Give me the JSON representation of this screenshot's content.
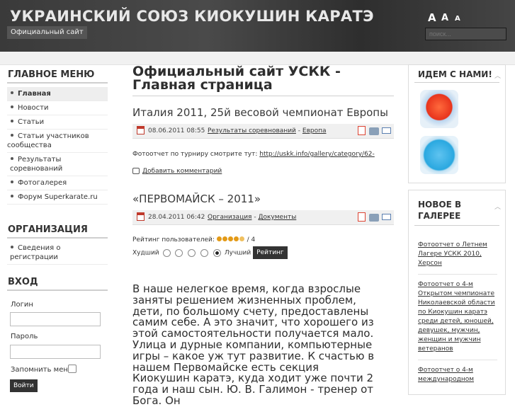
{
  "header": {
    "site_title": "УКРАИНСКИЙ СОЮЗ КИОКУШИН КАРАТЭ",
    "slogan": "Официальный сайт",
    "font_increase": "A",
    "font_reset": "A",
    "font_decrease": "A",
    "search_placeholder": "поиск..."
  },
  "main_menu": {
    "title": "ГЛАВНОЕ МЕНЮ",
    "items": [
      {
        "label": "Главная"
      },
      {
        "label": "Новости"
      },
      {
        "label": "Статьи"
      },
      {
        "label": "Статьи участников сообщества"
      },
      {
        "label": "Результаты соревнований"
      },
      {
        "label": "Фотогалерея"
      },
      {
        "label": "Форум Superkarate.ru"
      }
    ]
  },
  "org_menu": {
    "title": "ОРГАНИЗАЦИЯ",
    "items": [
      {
        "label": "Сведения о регистрации"
      }
    ]
  },
  "login": {
    "title": "ВХОД",
    "username_label": "Логин",
    "password_label": "Пароль",
    "remember_label": "Запомнить меня",
    "submit_label": "Войти"
  },
  "page": {
    "title": "Официальный сайт УСКК - Главная страница"
  },
  "articles": [
    {
      "title": "Италия 2011, 25й весовой чемпионат Европы",
      "date": "08.06.2011 08:55",
      "section": "Результаты соревнований",
      "category": "Европа",
      "body": "Фотоотчет по турниру смотрите тут: ",
      "link": "http://uskk.info/gallery/category/62-",
      "comment_label": "Добавить комментарий"
    },
    {
      "title": "«ПЕРВОМАЙСК – 2011»",
      "date": "28.04.2011 06:42",
      "section": "Организация",
      "category": "Документы",
      "rating_label": "Рейтинг пользователей:",
      "rating_value": "/ 4",
      "rating_stars": 4,
      "worst_label": "Худший",
      "best_label": "Лучший",
      "rate_button": "Рейтинг",
      "body": "В наше нелегкое время, когда взрослые заняты решением жизненных проблем, дети, по большому счету, предоставлены самим себе. А это значит, что хорошего из этой самостоятельности получается мало. Улица и дурные компании, компьютерные игры – какое уж тут развитие. К счастью в нашем Первомайске есть секция Киокушин каратэ, куда ходит уже почти 2 года и наш сын. Ю. В. Галимон - тренер от Бога. Он"
    }
  ],
  "right": {
    "social_title": "ИДЕМ С НАМИ!",
    "gallery_title": "НОВОЕ В ГАЛЕРЕЕ",
    "gallery_items": [
      {
        "label": "Фотоотчет о Летнем Лагере УСКК 2010, Херсон"
      },
      {
        "label": "Фотоотчет о 4-м Открытом чемпионате Николаевской области по Киокушин каратэ среди детей, юношей, девушек, мужчин, женщин и мужчин ветеранов"
      },
      {
        "label": "Фотоотчет о 4-м международном"
      }
    ]
  },
  "colors": {
    "header_bg": "#3d3d3d",
    "accent": "#e39a17",
    "text": "#333333"
  }
}
